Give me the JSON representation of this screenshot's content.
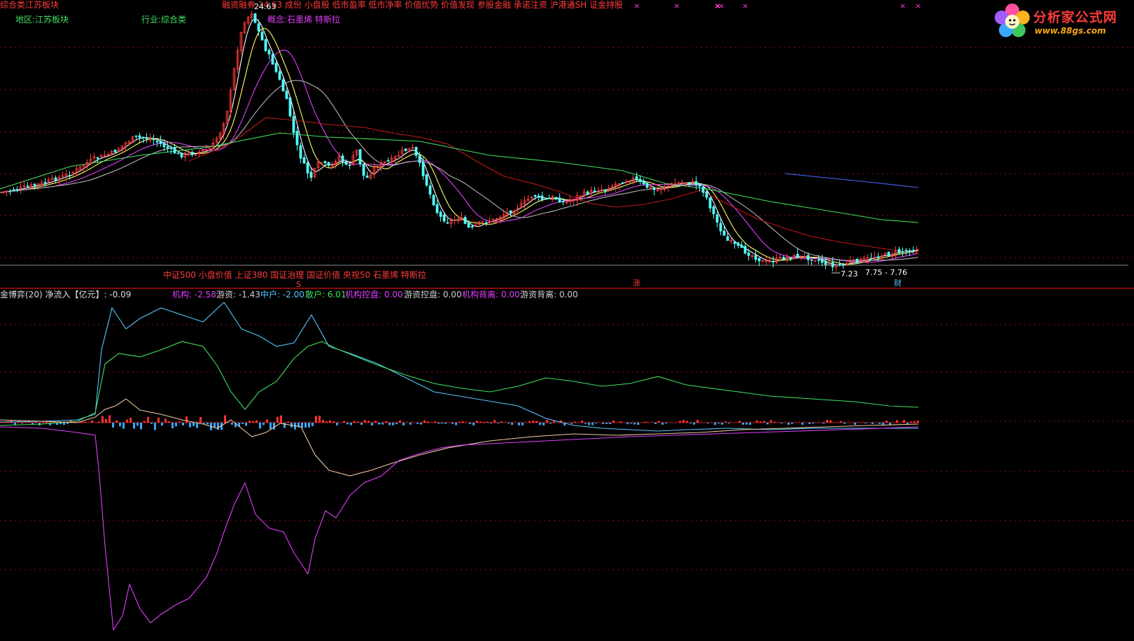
{
  "header": {
    "sector": "综合类江苏板块",
    "region_label": "地区:江苏板块",
    "industry_label": "行业:综合类",
    "tags": "融资融券 24.63 成份 小盘股 低市盈率 低市净率 价值优势 价值发现 参股金融 承诺注资 沪港通SH 证金持股",
    "concept_label": "概念:石墨烯 特斯拉",
    "price_high": "24.63",
    "window_buttons": [
      "×",
      "×",
      "×",
      "×",
      "×",
      "×",
      "×",
      "×"
    ]
  },
  "logo": {
    "title": "分析家公式网",
    "url": "www.88gs.com"
  },
  "main_chart": {
    "index_tags": "中证500 小盘价值 上证380 国证治理 国证价值 央视50 石墨烯 特斯拉",
    "price_low": "7.23",
    "price_range": "7.75 - 7.76",
    "markers": [
      "S",
      "涨",
      "财"
    ],
    "colors": {
      "up": "#ff3b3b",
      "down": "#54ffff",
      "ma5": "#ffffff",
      "ma10": "#ffff66",
      "ma20": "#e040fb",
      "ma30": "#b4b4b4",
      "ma60": "#40e060",
      "ma120": "#c01818",
      "ma250": "#4466ff"
    }
  },
  "indicator": {
    "title": "金博弈(20) 净流入【亿元】: -0.09",
    "legend": [
      {
        "label": "机构: -2.58",
        "color": "#e040fb"
      },
      {
        "label": "游资: -1.43",
        "color": "#cfcfcf"
      },
      {
        "label": "中户: -2.00",
        "color": "#54c8ff"
      },
      {
        "label": "散户: 6.01",
        "color": "#40e060"
      },
      {
        "label": "机构控盘: 0.00",
        "color": "#e040fb"
      },
      {
        "label": "游资控盘: 0.00",
        "color": "#cfcfcf"
      },
      {
        "label": "机构背离: 0.00",
        "color": "#e040fb"
      },
      {
        "label": "游资背离: 0.00",
        "color": "#cfcfcf"
      }
    ]
  }
}
